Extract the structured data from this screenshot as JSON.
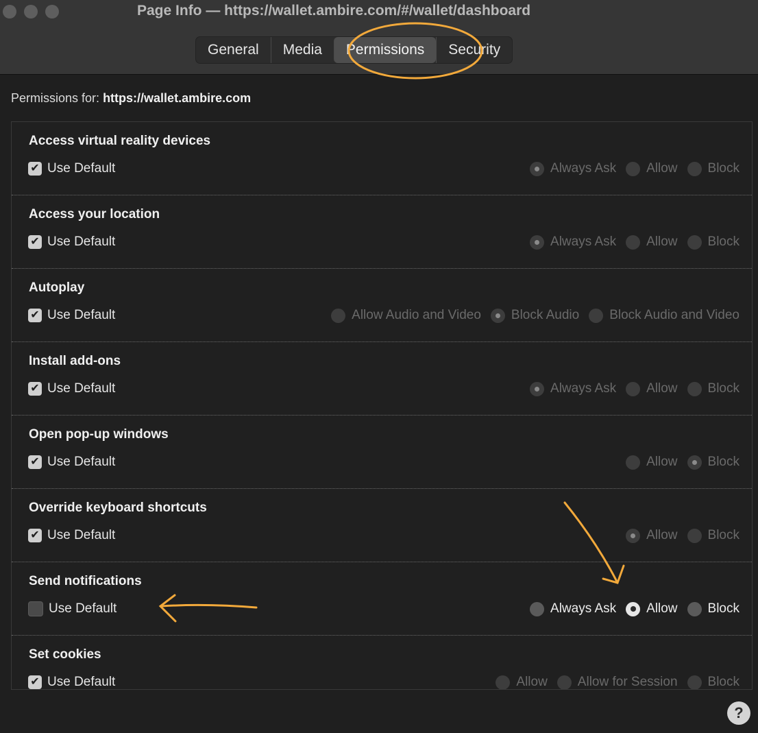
{
  "window": {
    "title": "Page Info — https://wallet.ambire.com/#/wallet/dashboard"
  },
  "tabs": [
    {
      "label": "General",
      "active": false
    },
    {
      "label": "Media",
      "active": false
    },
    {
      "label": "Permissions",
      "active": true
    },
    {
      "label": "Security",
      "active": false
    }
  ],
  "permissions_for": {
    "label": "Permissions for:",
    "site": "https://wallet.ambire.com"
  },
  "permissions": [
    {
      "title": "Access virtual reality devices",
      "use_default_label": "Use Default",
      "use_default": true,
      "options": [
        "Always Ask",
        "Allow",
        "Block"
      ],
      "selected": 0
    },
    {
      "title": "Access your location",
      "use_default_label": "Use Default",
      "use_default": true,
      "options": [
        "Always Ask",
        "Allow",
        "Block"
      ],
      "selected": 0
    },
    {
      "title": "Autoplay",
      "use_default_label": "Use Default",
      "use_default": true,
      "options": [
        "Allow Audio and Video",
        "Block Audio",
        "Block Audio and Video"
      ],
      "selected": 1
    },
    {
      "title": "Install add-ons",
      "use_default_label": "Use Default",
      "use_default": true,
      "options": [
        "Always Ask",
        "Allow",
        "Block"
      ],
      "selected": 0
    },
    {
      "title": "Open pop-up windows",
      "use_default_label": "Use Default",
      "use_default": true,
      "options": [
        "Allow",
        "Block"
      ],
      "selected": 1
    },
    {
      "title": "Override keyboard shortcuts",
      "use_default_label": "Use Default",
      "use_default": true,
      "options": [
        "Allow",
        "Block"
      ],
      "selected": 0
    },
    {
      "title": "Send notifications",
      "use_default_label": "Use Default",
      "use_default": false,
      "options": [
        "Always Ask",
        "Allow",
        "Block"
      ],
      "selected": 1
    },
    {
      "title": "Set cookies",
      "use_default_label": "Use Default",
      "use_default": true,
      "options": [
        "Allow",
        "Allow for Session",
        "Block"
      ],
      "selected": -1
    }
  ],
  "help": {
    "label": "?"
  },
  "colors": {
    "annotation": "#f2a93b"
  }
}
